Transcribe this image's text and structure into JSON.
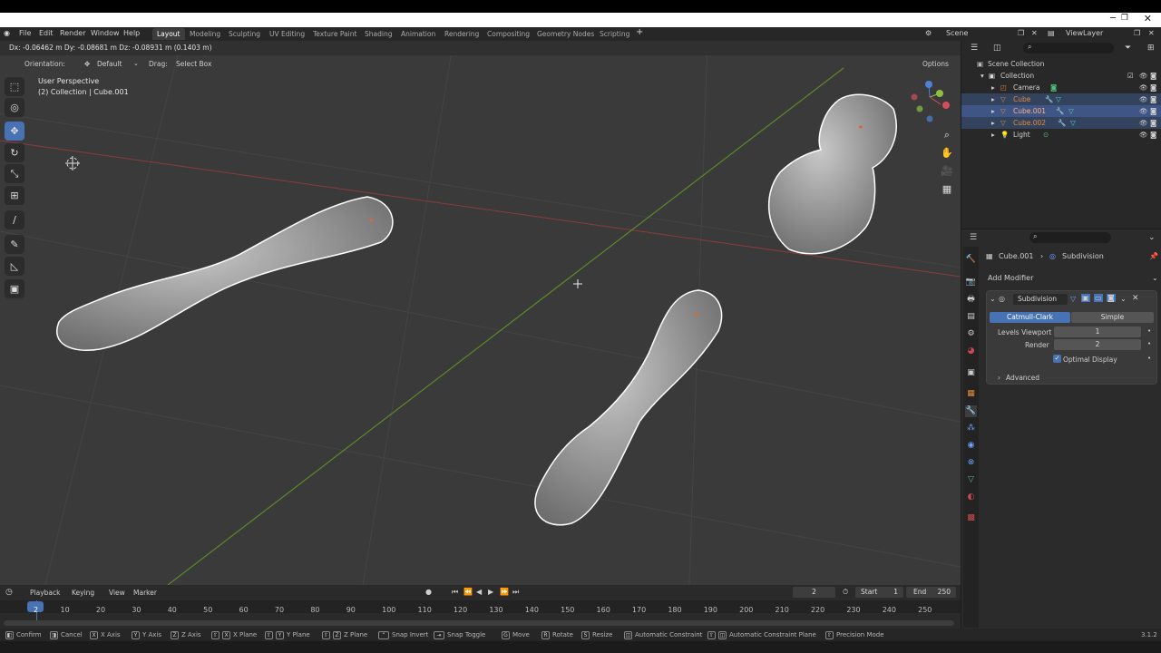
{
  "menu": {
    "file": "File",
    "edit": "Edit",
    "render": "Render",
    "window": "Window",
    "help": "Help"
  },
  "workspaces": [
    "Layout",
    "Modeling",
    "Sculpting",
    "UV Editing",
    "Texture Paint",
    "Shading",
    "Animation",
    "Rendering",
    "Compositing",
    "Geometry Nodes",
    "Scripting"
  ],
  "scene": {
    "label": "Scene",
    "viewlayer": "ViewLayer"
  },
  "viewport": {
    "transform_readout": "Dx: -0.06462 m  Dy: -0.08681 m  Dz: -0.08931 m (0.1403 m)",
    "orientation_label": "Orientation:",
    "orientation_value": "Default",
    "drag_label": "Drag:",
    "drag_value": "Select Box",
    "options": "Options",
    "perspective": "User Perspective",
    "collection_info": "(2) Collection | Cube.001"
  },
  "outliner": {
    "items": [
      {
        "name": "Scene Collection"
      },
      {
        "name": "Collection"
      },
      {
        "name": "Camera"
      },
      {
        "name": "Cube"
      },
      {
        "name": "Cube.001"
      },
      {
        "name": "Cube.002"
      },
      {
        "name": "Light"
      }
    ]
  },
  "properties": {
    "object": "Cube.001",
    "modifier_crumb": "Subdivision",
    "add_modifier": "Add Modifier",
    "modifier_name": "Subdivision",
    "catmull": "Catmull-Clark",
    "simple": "Simple",
    "levels_viewport_label": "Levels Viewport",
    "levels_viewport": "1",
    "render_label": "Render",
    "render_value": "2",
    "optimal_display": "Optimal Display",
    "advanced": "Advanced"
  },
  "timeline": {
    "playback": "Playback",
    "keying": "Keying",
    "view": "View",
    "marker": "Marker",
    "current_frame": "2",
    "start_label": "Start",
    "start": "1",
    "end_label": "End",
    "end": "250",
    "ticks": [
      "2",
      "10",
      "20",
      "30",
      "40",
      "50",
      "60",
      "70",
      "80",
      "90",
      "100",
      "110",
      "120",
      "130",
      "140",
      "150",
      "160",
      "170",
      "180",
      "190",
      "200",
      "210",
      "220",
      "230",
      "240",
      "250"
    ]
  },
  "status": {
    "confirm": "Confirm",
    "cancel": "Cancel",
    "x_axis": "X Axis",
    "y_axis": "Y Axis",
    "z_axis": "Z Axis",
    "x_plane": "X Plane",
    "y_plane": "Y Plane",
    "z_plane": "Z Plane",
    "snap_invert": "Snap Invert",
    "snap_toggle": "Snap Toggle",
    "move": "Move",
    "rotate": "Rotate",
    "resize": "Resize",
    "auto_constraint": "Automatic Constraint",
    "auto_constraint_plane": "Automatic Constraint Plane",
    "precision": "Precision Mode",
    "version": "3.1.2"
  },
  "colors": {
    "accent": "#4772b3",
    "selection_outline": "#ffffff",
    "x_axis": "#8b3b3b",
    "y_axis": "#5a8a2a"
  }
}
